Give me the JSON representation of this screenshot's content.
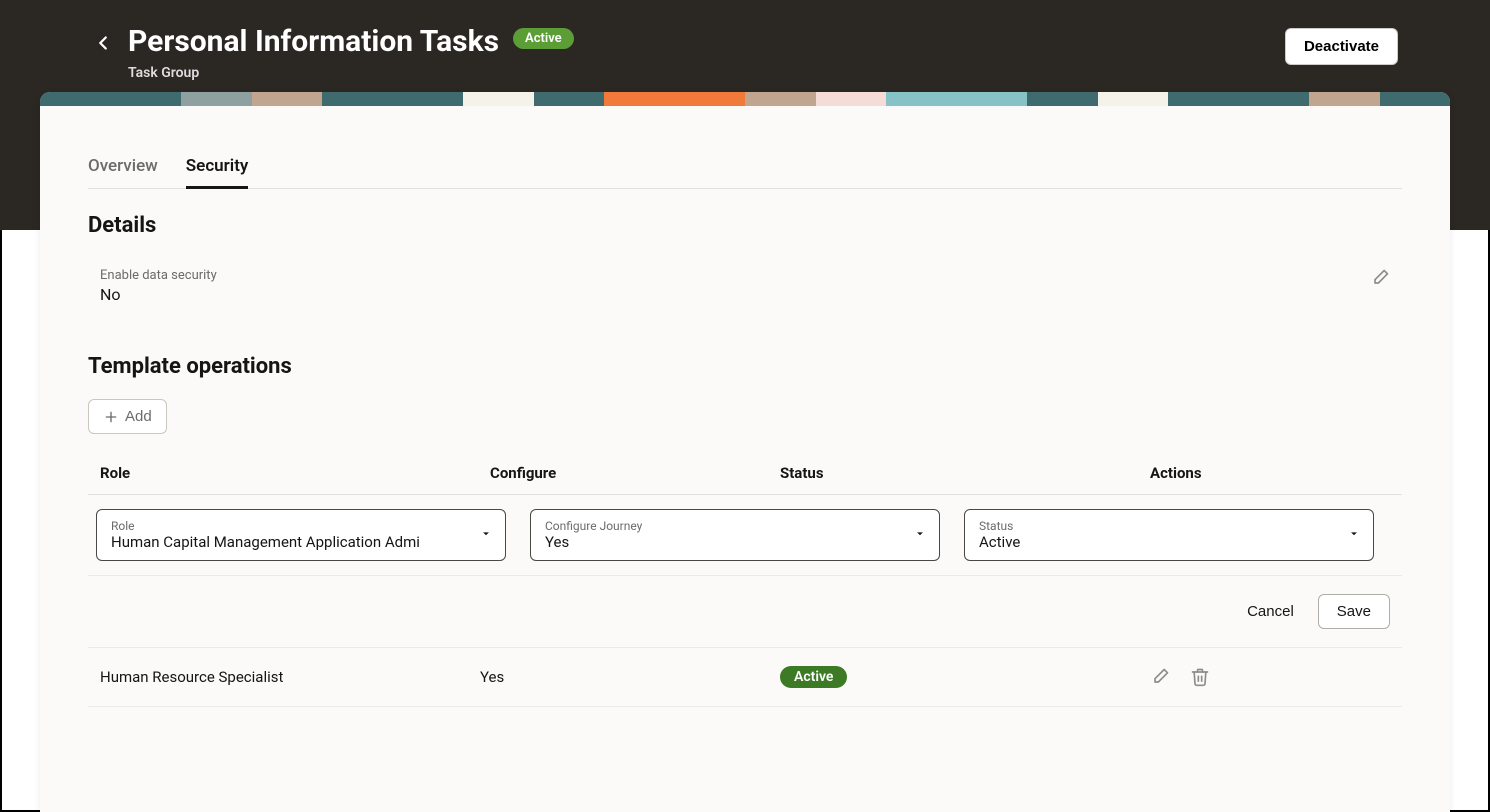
{
  "header": {
    "title": "Personal Information Tasks",
    "status_badge": "Active",
    "subtitle": "Task Group",
    "deactivate_label": "Deactivate"
  },
  "tabs": [
    {
      "label": "Overview",
      "active": false
    },
    {
      "label": "Security",
      "active": true
    }
  ],
  "details": {
    "section_title": "Details",
    "enable_label": "Enable data security",
    "enable_value": "No"
  },
  "template_ops": {
    "section_title": "Template operations",
    "add_label": "Add",
    "columns": {
      "role": "Role",
      "configure": "Configure",
      "status": "Status",
      "actions": "Actions"
    },
    "edit_row": {
      "role_label": "Role",
      "role_value": "Human Capital Management Application Admi",
      "configure_label": "Configure Journey",
      "configure_value": "Yes",
      "status_label": "Status",
      "status_value": "Active",
      "cancel_label": "Cancel",
      "save_label": "Save"
    },
    "rows": [
      {
        "role": "Human Resource Specialist",
        "configure": "Yes",
        "status": "Active"
      }
    ]
  },
  "colors": {
    "strip": [
      "#3f6a6e",
      "#8fa0a1",
      "#c1a58f",
      "#3f6a6e",
      "#f5f2ea",
      "#3f6a6e",
      "#f17a3a",
      "#c1a58f",
      "#f5dcd6",
      "#87c2c7",
      "#3f6a6e",
      "#f5f2ea",
      "#3f6a6e",
      "#c1a58f",
      "#3f6a6e"
    ]
  }
}
